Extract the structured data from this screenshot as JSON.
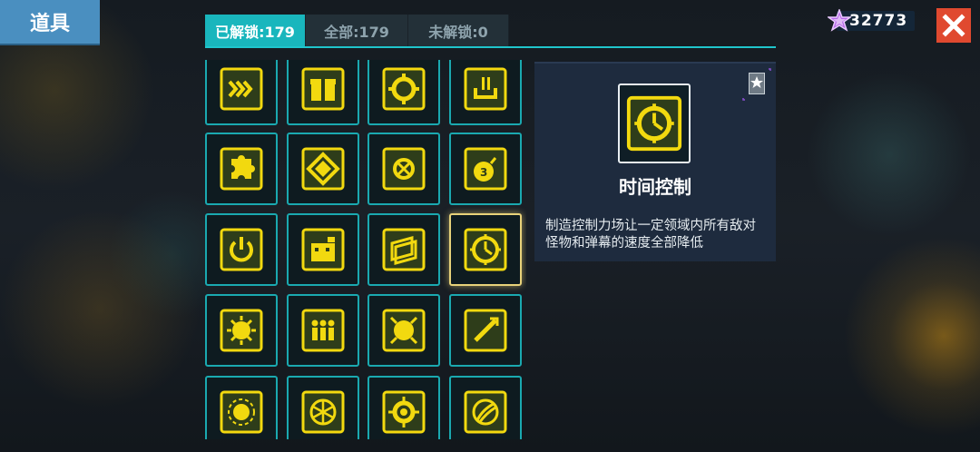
{
  "header": {
    "title": "道具"
  },
  "tabs": [
    {
      "label": "已解锁:179",
      "active": true
    },
    {
      "label": "全部:179",
      "active": false
    },
    {
      "label": "未解锁:0",
      "active": false
    }
  ],
  "currency": {
    "amount": "32773",
    "icon": "star-gem-icon"
  },
  "close": {
    "icon": "close-icon"
  },
  "items": [
    {
      "icon": "chevrons-icon"
    },
    {
      "icon": "gift-box-icon"
    },
    {
      "icon": "target-ring-icon"
    },
    {
      "icon": "power-plug-icon"
    },
    {
      "icon": "puzzle-piece-icon"
    },
    {
      "icon": "diamond-icon"
    },
    {
      "icon": "crosshair-icon"
    },
    {
      "icon": "bomb-icon"
    },
    {
      "icon": "power-button-icon"
    },
    {
      "icon": "robot-face-icon"
    },
    {
      "icon": "layered-cards-icon"
    },
    {
      "icon": "time-control-icon",
      "selected": true
    },
    {
      "icon": "spiky-face-icon"
    },
    {
      "icon": "people-icon"
    },
    {
      "icon": "sun-orb-icon"
    },
    {
      "icon": "sword-slash-icon"
    },
    {
      "icon": "gear-burst-icon"
    },
    {
      "icon": "snowflake-icon"
    },
    {
      "icon": "spiked-ring-icon"
    },
    {
      "icon": "claw-swipe-icon"
    }
  ],
  "detail": {
    "name": "时间控制",
    "description": "制造控制力场让一定领域内所有敌对怪物和弹幕的速度全部降低",
    "icon": "time-control-icon",
    "badge_icon": "star-badge-icon"
  },
  "colors": {
    "accent": "#19b6bd",
    "icon": "#f2d90f",
    "close": "#e0492f",
    "title": "#4a8fc0"
  }
}
